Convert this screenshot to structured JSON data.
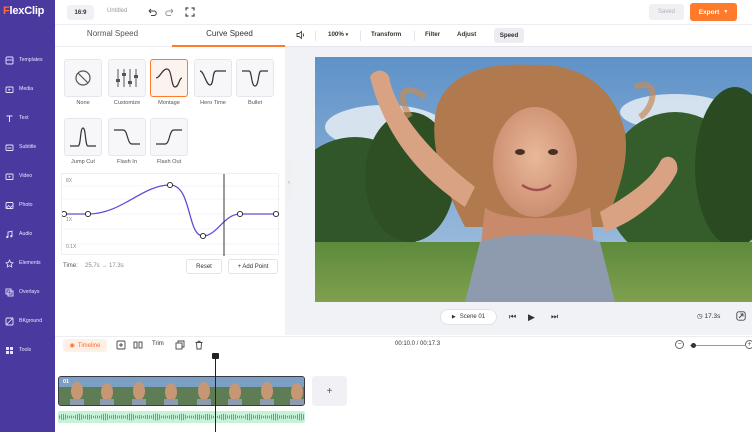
{
  "app": {
    "logo_prefix": "F",
    "logo_rest": "lexClip"
  },
  "sidebar": {
    "items": [
      {
        "label": "Templates",
        "icon": "templates-icon"
      },
      {
        "label": "Media",
        "icon": "media-icon"
      },
      {
        "label": "Text",
        "icon": "text-icon"
      },
      {
        "label": "Subtitle",
        "icon": "subtitle-icon"
      },
      {
        "label": "Video",
        "icon": "video-icon"
      },
      {
        "label": "Photo",
        "icon": "photo-icon"
      },
      {
        "label": "Audio",
        "icon": "audio-icon"
      },
      {
        "label": "Elements",
        "icon": "elements-icon"
      },
      {
        "label": "Overlays",
        "icon": "overlays-icon"
      },
      {
        "label": "BKground",
        "icon": "background-icon"
      },
      {
        "label": "Tools",
        "icon": "tools-icon"
      }
    ]
  },
  "topbar": {
    "aspect_ratio": "16:9",
    "title": "Untitled",
    "saved_label": "Saved",
    "export_label": "Export",
    "accent": "#ff7a2b"
  },
  "speed_panel": {
    "tabs": [
      "Normal Speed",
      "Curve Speed"
    ],
    "active_tab": "Curve Speed",
    "presets": [
      {
        "label": "None",
        "icon": "none-icon"
      },
      {
        "label": "Customize",
        "icon": "customize-icon"
      },
      {
        "label": "Montage",
        "icon": "montage-curve-icon",
        "selected": true
      },
      {
        "label": "Hero Time",
        "icon": "hero-time-curve-icon"
      },
      {
        "label": "Bullet",
        "icon": "bullet-curve-icon"
      },
      {
        "label": "Jump Cut",
        "icon": "jump-cut-curve-icon"
      },
      {
        "label": "Flash In",
        "icon": "flash-in-curve-icon"
      },
      {
        "label": "Flash Out",
        "icon": "flash-out-curve-icon"
      }
    ],
    "graph": {
      "max_label": "8X",
      "mid_label": "1X",
      "min_label": "0.1X"
    },
    "time_label": "Time:",
    "time_from": "25.7s",
    "time_arrow": "→",
    "time_to": "17.3s",
    "reset_label": "Reset",
    "add_point_label": "+ Add Point"
  },
  "preview_toolbar": {
    "zoom": "100%",
    "items": [
      "Transform",
      "Filter",
      "Adjust",
      "Speed"
    ],
    "active": "Speed"
  },
  "player": {
    "scene_label": "Scene 01",
    "duration": "17.3s"
  },
  "timeline": {
    "label": "Timeline",
    "trim_label": "Trim",
    "time": "00:10.0 / 00:17.3",
    "clip_number": "01",
    "add_label": "+"
  }
}
